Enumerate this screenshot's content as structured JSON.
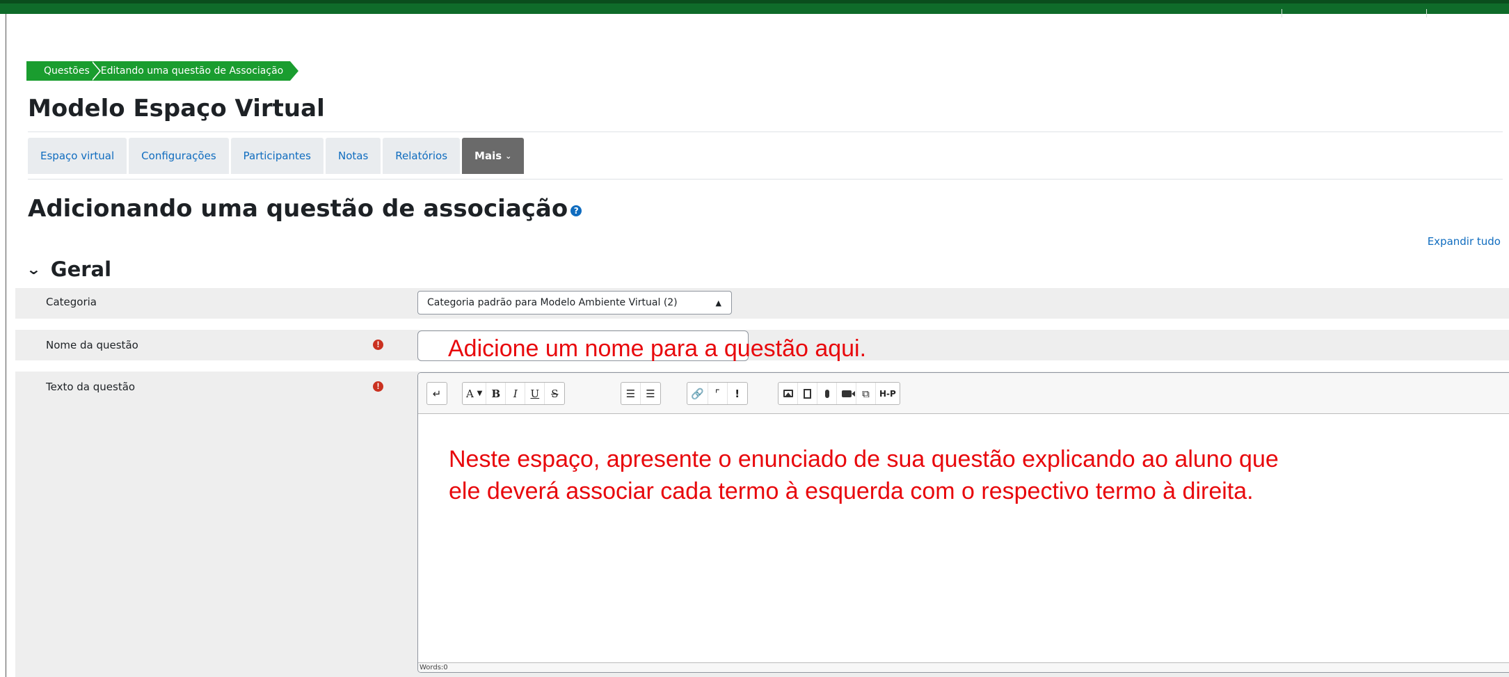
{
  "breadcrumb": {
    "items": [
      "Questões",
      "Editando uma questão de Associação"
    ]
  },
  "course": {
    "title": "Modelo Espaço Virtual"
  },
  "tabs": [
    {
      "label": "Espaço virtual"
    },
    {
      "label": "Configurações"
    },
    {
      "label": "Participantes"
    },
    {
      "label": "Notas"
    },
    {
      "label": "Relatórios"
    },
    {
      "label": "Mais"
    }
  ],
  "heading": {
    "title": "Adicionando uma questão de associação",
    "help_icon": "question-circle-icon"
  },
  "expand_all": "Expandir tudo",
  "section": {
    "title": "Geral",
    "icon": "chevron-down-icon"
  },
  "fields": {
    "category": {
      "label": "Categoria",
      "value": "Categoria padrão para Modelo Ambiente Virtual (2)"
    },
    "name": {
      "label": "Nome da questão",
      "value": "",
      "annotation": "Adicione um nome para a questão aqui."
    },
    "text": {
      "label": "Texto da questão",
      "annotation_line1": "Neste espaço, apresente o enunciado de sua questão explicando ao aluno que",
      "annotation_line2": "ele deverá associar cada termo à esquerda com o respectivo termo à direita.",
      "word_count_label": "Words:",
      "word_count": "0"
    }
  },
  "toolbar": {
    "bold": "B",
    "italic": "I",
    "underline": "U",
    "strike": "S",
    "font": "A",
    "bang": "!",
    "h5p": "H-P"
  },
  "colors": {
    "topbar": "#0f6b2a",
    "breadcrumb": "#1a9d2f",
    "link": "#0f6cbf",
    "required": "#ca3120",
    "annotation": "#e8080c",
    "active_tab": "#6a6a6a"
  }
}
